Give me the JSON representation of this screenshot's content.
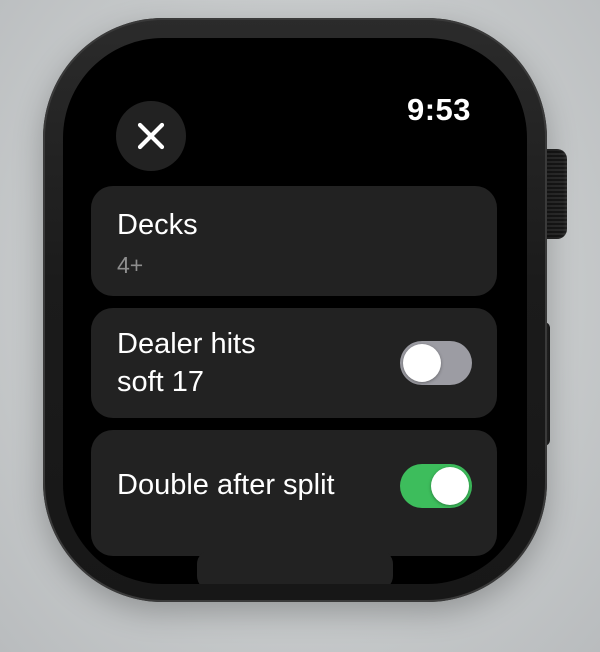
{
  "status_bar": {
    "time": "9:53"
  },
  "close_button": {
    "icon": "close-icon"
  },
  "settings": {
    "decks": {
      "label": "Decks",
      "value": "4+"
    },
    "dealer_hits_soft_17": {
      "label_line1": "Dealer hits",
      "label_line2": "soft 17",
      "enabled": false
    },
    "double_after_split": {
      "label": "Double after split",
      "enabled": true
    }
  },
  "colors": {
    "toggle_on": "#3dbd5c",
    "toggle_off": "#9c9ca3",
    "row_background": "#222222",
    "screen_background": "#000000"
  }
}
